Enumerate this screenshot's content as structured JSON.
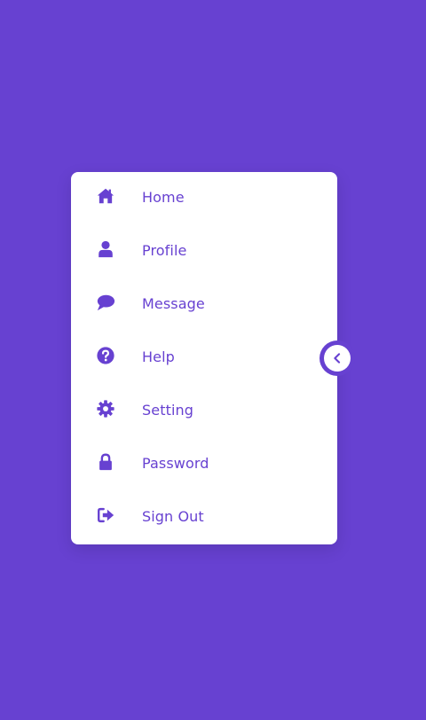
{
  "theme": {
    "background": "#6741d1",
    "card_background": "#ffffff",
    "accent": "#6741d1"
  },
  "menu": {
    "items": [
      {
        "label": "Home",
        "icon": "home-icon"
      },
      {
        "label": "Profile",
        "icon": "user-icon"
      },
      {
        "label": "Message",
        "icon": "speech-bubble-icon"
      },
      {
        "label": "Help",
        "icon": "question-circle-icon"
      },
      {
        "label": "Setting",
        "icon": "gear-icon"
      },
      {
        "label": "Password",
        "icon": "lock-icon"
      },
      {
        "label": "Sign Out",
        "icon": "sign-out-icon"
      }
    ]
  },
  "toggle": {
    "icon": "chevron-left-icon"
  }
}
